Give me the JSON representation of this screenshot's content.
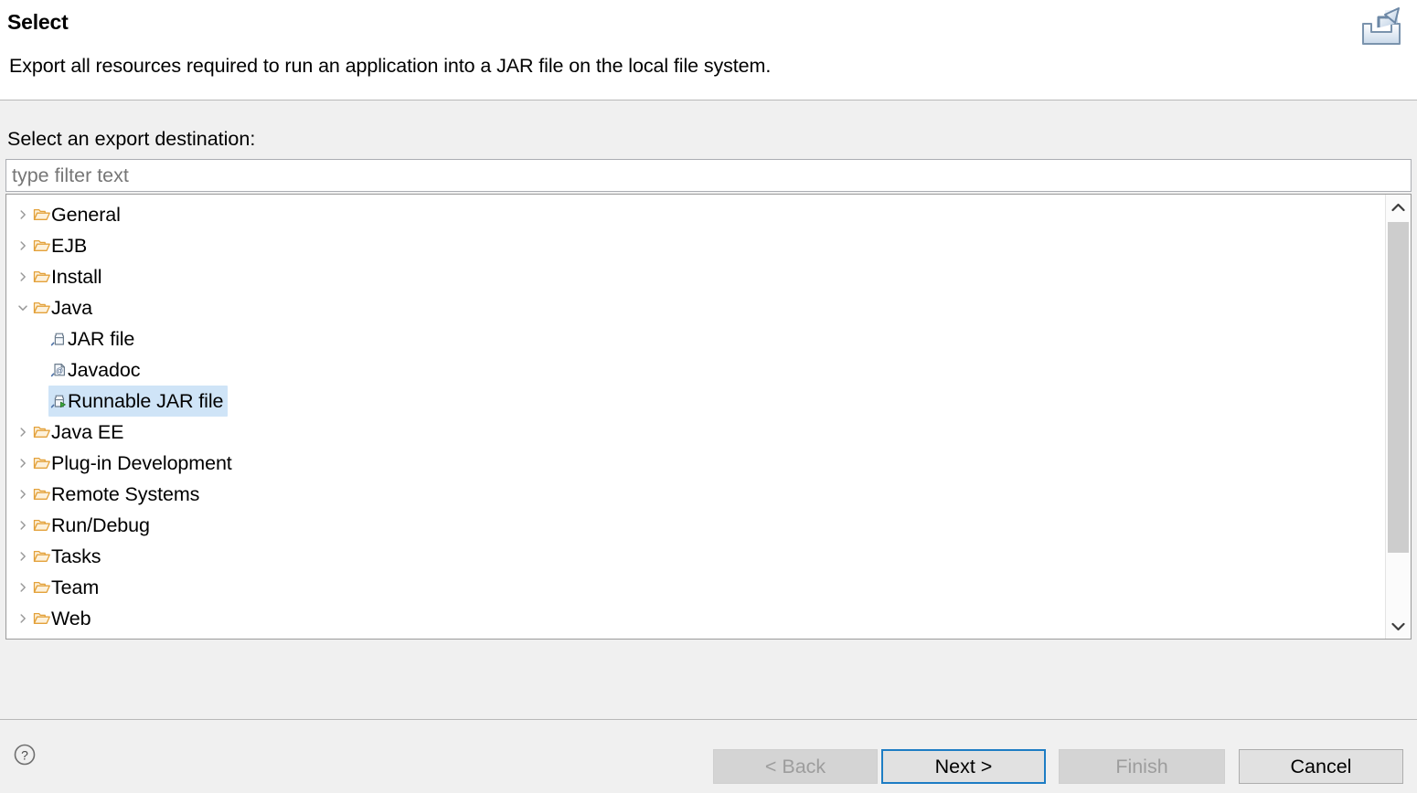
{
  "header": {
    "title": "Select",
    "description": "Export all resources required to run an application into a JAR file on the local file system.",
    "icon": "export-wizard-icon"
  },
  "body": {
    "destination_label": "Select an export destination:",
    "filter": {
      "placeholder": "type filter text",
      "value": ""
    },
    "tree": {
      "selected": "Runnable JAR file",
      "selection_color": "#cfe4f7",
      "items": [
        {
          "label": "General",
          "level": 0,
          "icon": "folder-icon",
          "expanded": false,
          "has_children": true
        },
        {
          "label": "EJB",
          "level": 0,
          "icon": "folder-icon",
          "expanded": false,
          "has_children": true
        },
        {
          "label": "Install",
          "level": 0,
          "icon": "folder-icon",
          "expanded": false,
          "has_children": true
        },
        {
          "label": "Java",
          "level": 0,
          "icon": "folder-icon",
          "expanded": true,
          "has_children": true
        },
        {
          "label": "JAR file",
          "level": 1,
          "icon": "jar-file-icon",
          "expanded": false,
          "has_children": false
        },
        {
          "label": "Javadoc",
          "level": 1,
          "icon": "javadoc-icon",
          "expanded": false,
          "has_children": false
        },
        {
          "label": "Runnable JAR file",
          "level": 1,
          "icon": "runnable-jar-file-icon",
          "expanded": false,
          "has_children": false,
          "selected": true
        },
        {
          "label": "Java EE",
          "level": 0,
          "icon": "folder-icon",
          "expanded": false,
          "has_children": true
        },
        {
          "label": "Plug-in Development",
          "level": 0,
          "icon": "folder-icon",
          "expanded": false,
          "has_children": true
        },
        {
          "label": "Remote Systems",
          "level": 0,
          "icon": "folder-icon",
          "expanded": false,
          "has_children": true
        },
        {
          "label": "Run/Debug",
          "level": 0,
          "icon": "folder-icon",
          "expanded": false,
          "has_children": true
        },
        {
          "label": "Tasks",
          "level": 0,
          "icon": "folder-icon",
          "expanded": false,
          "has_children": true
        },
        {
          "label": "Team",
          "level": 0,
          "icon": "folder-icon",
          "expanded": false,
          "has_children": true
        },
        {
          "label": "Web",
          "level": 0,
          "icon": "folder-icon",
          "expanded": false,
          "has_children": true
        }
      ],
      "scrollbar": {
        "up_icon": "chevron-up-icon",
        "down_icon": "chevron-down-icon"
      }
    }
  },
  "footer": {
    "help_icon": "help-icon",
    "buttons": [
      {
        "id": "btn-back",
        "label": "< Back",
        "state": "disabled"
      },
      {
        "id": "btn-next",
        "label": "Next >",
        "state": "focused"
      },
      {
        "id": "btn-finish",
        "label": "Finish",
        "state": "disabled"
      },
      {
        "id": "btn-cancel",
        "label": "Cancel",
        "state": "enabled"
      }
    ],
    "focus_color": "#1d7dc4"
  }
}
